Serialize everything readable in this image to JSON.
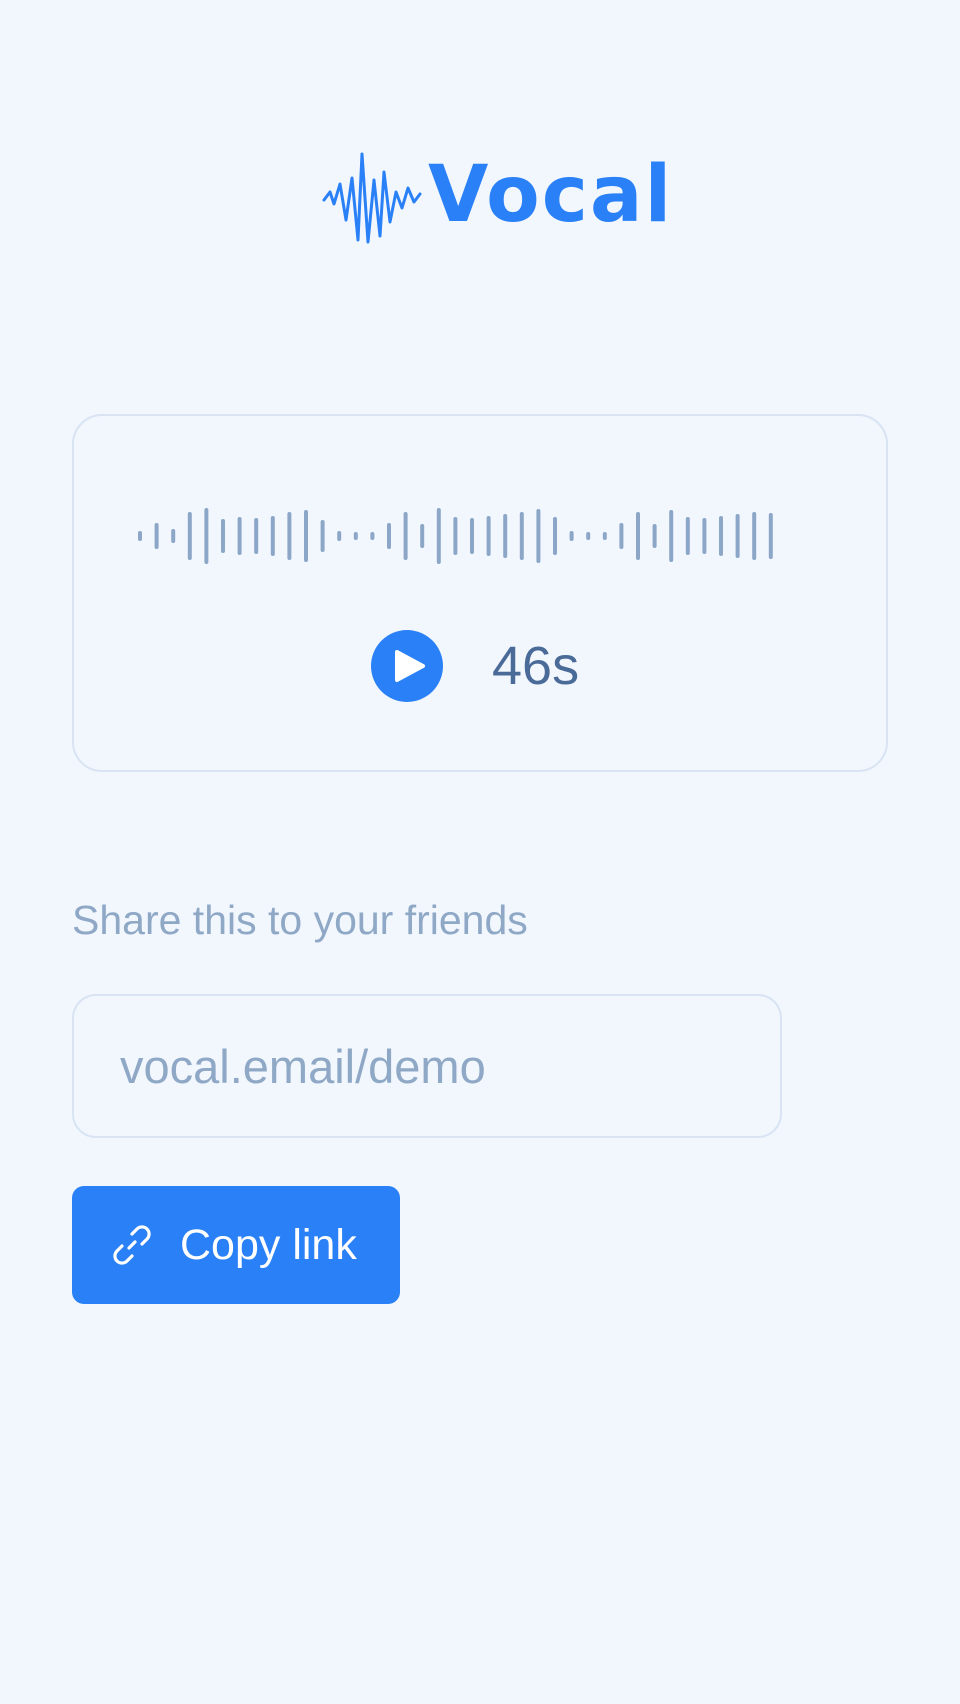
{
  "brand": {
    "name": "Vocal",
    "color": "#2a80f6",
    "icon": "soundwave-icon"
  },
  "player": {
    "duration": "46s",
    "play_icon": "play-icon",
    "waveform_icon": "waveform-icon",
    "waveform_color": "#8ba6c7"
  },
  "share": {
    "label": "Share this to your friends",
    "link": "vocal.email/demo",
    "copy_label": "Copy link",
    "copy_icon": "link-icon"
  },
  "colors": {
    "background": "#f2f7fe",
    "accent": "#2a80f6",
    "border": "#d8e4f3",
    "muted_text": "#8ea8c6",
    "duration_text": "#4a6a98"
  }
}
